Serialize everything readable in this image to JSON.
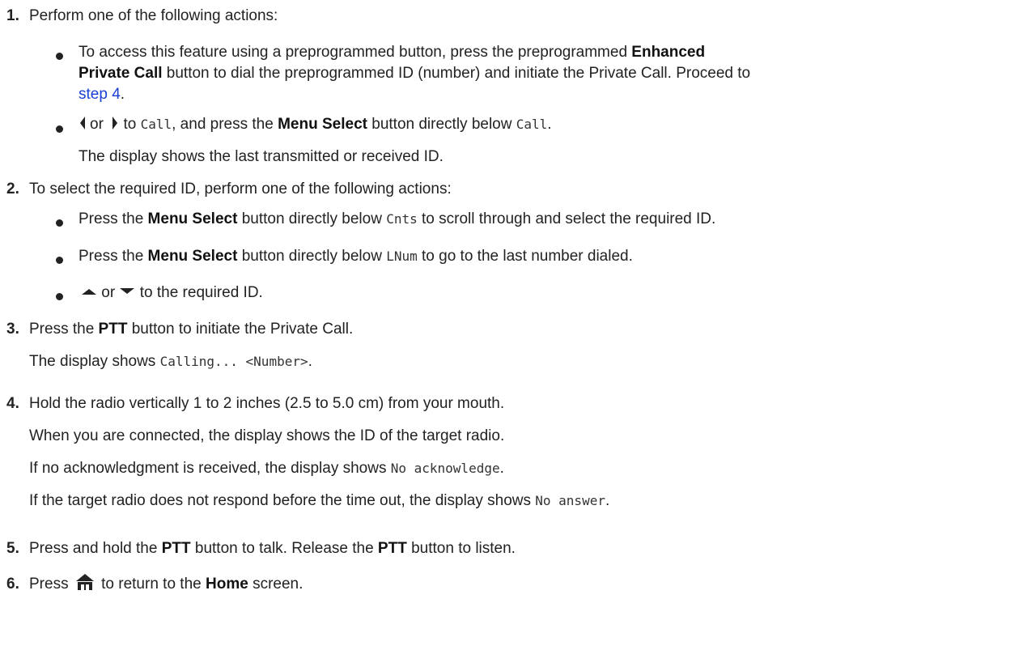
{
  "steps": [
    {
      "number": "1.",
      "text": "Perform one of the following actions:",
      "bullets": [
        {
          "line1_pre": "To access this feature using a preprogrammed button, press the preprogrammed ",
          "line1_bold": "Enhanced",
          "line2_bold": "Private Call",
          "line2_post": " button to dial the preprogrammed ID (number) and initiate the Private Call. Proceed to",
          "link": "step 4",
          "link_post": "."
        },
        {
          "or": "or",
          "to": " to ",
          "code1": "Call",
          "mid": ", and press the ",
          "bold": "Menu Select",
          "after_bold": " button directly below ",
          "code2": "Call",
          "end": ".",
          "result": "The display shows the last transmitted or received ID."
        }
      ]
    },
    {
      "number": "2.",
      "text": "To select the required ID, perform one of the following actions:",
      "bullets": [
        {
          "pre": "Press the ",
          "bold": "Menu Select",
          "mid": " button directly below ",
          "code": "Cnts",
          "post": " to scroll through and select the required ID."
        },
        {
          "pre": "Press the ",
          "bold": "Menu Select",
          "mid": " button directly below ",
          "code": "LNum",
          "post": " to go to the last number dialed."
        },
        {
          "or": " or ",
          "post": " to the required ID."
        }
      ]
    },
    {
      "number": "3.",
      "pre": "Press the ",
      "bold": "PTT",
      "post": " button to initiate the Private Call.",
      "result_pre": "The display shows ",
      "result_code": "Calling... <Number>",
      "result_post": "."
    },
    {
      "number": "4.",
      "text": "Hold the radio vertically 1 to 2 inches (2.5 to 5.0 cm) from your mouth.",
      "line2": "When you are connected, the display shows the ID of the target radio.",
      "line3_pre": "If no acknowledgment is received, the display shows ",
      "line3_code": "No acknowledge",
      "line3_post": ".",
      "line4_pre": "If the target radio does not respond before the time out, the display shows ",
      "line4_code": "No answer",
      "line4_post": "."
    },
    {
      "number": "5.",
      "pre": "Press and hold the ",
      "bold1": "PTT",
      "mid": " button to talk. Release the ",
      "bold2": "PTT",
      "post": " button to listen."
    },
    {
      "number": "6.",
      "pre": "Press ",
      "mid": " to return to the ",
      "bold": "Home",
      "post": " screen."
    }
  ],
  "icons": {
    "left": "left-arrow-icon",
    "right": "right-arrow-icon",
    "up": "up-arrow-icon",
    "down": "down-arrow-icon",
    "home": "home-icon"
  }
}
